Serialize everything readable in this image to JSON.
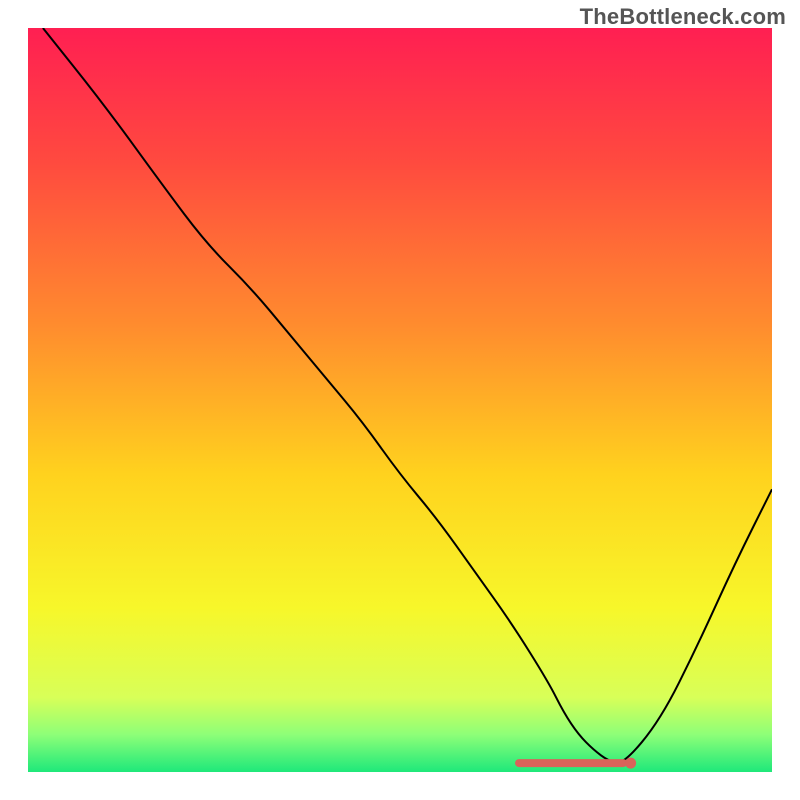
{
  "watermark": "TheBottleneck.com",
  "chart_data": {
    "type": "line",
    "title": "",
    "xlabel": "",
    "ylabel": "",
    "xlim": [
      0,
      100
    ],
    "ylim": [
      0,
      100
    ],
    "grid": false,
    "legend": false,
    "background_gradient": {
      "stops": [
        {
          "pos": 0.0,
          "color": "#ff1f52"
        },
        {
          "pos": 0.18,
          "color": "#ff4a3f"
        },
        {
          "pos": 0.4,
          "color": "#ff8c2e"
        },
        {
          "pos": 0.6,
          "color": "#ffd21e"
        },
        {
          "pos": 0.78,
          "color": "#f7f72a"
        },
        {
          "pos": 0.9,
          "color": "#d8ff58"
        },
        {
          "pos": 0.95,
          "color": "#8dff78"
        },
        {
          "pos": 1.0,
          "color": "#1ee87a"
        }
      ]
    },
    "series": [
      {
        "name": "bottleneck-curve",
        "x": [
          2,
          10,
          18,
          24,
          30,
          35,
          40,
          45,
          50,
          55,
          60,
          65,
          70,
          72,
          74,
          76,
          78,
          80,
          85,
          90,
          95,
          100
        ],
        "y": [
          100,
          90,
          79,
          71,
          65,
          59,
          53,
          47,
          40,
          34,
          27,
          20,
          12,
          8,
          5,
          3,
          1.5,
          1,
          7,
          17,
          28,
          38
        ]
      }
    ],
    "markers": {
      "name": "highlight-band",
      "x_range": [
        66,
        80
      ],
      "y": 1.2,
      "end_dot_x": 81
    }
  }
}
